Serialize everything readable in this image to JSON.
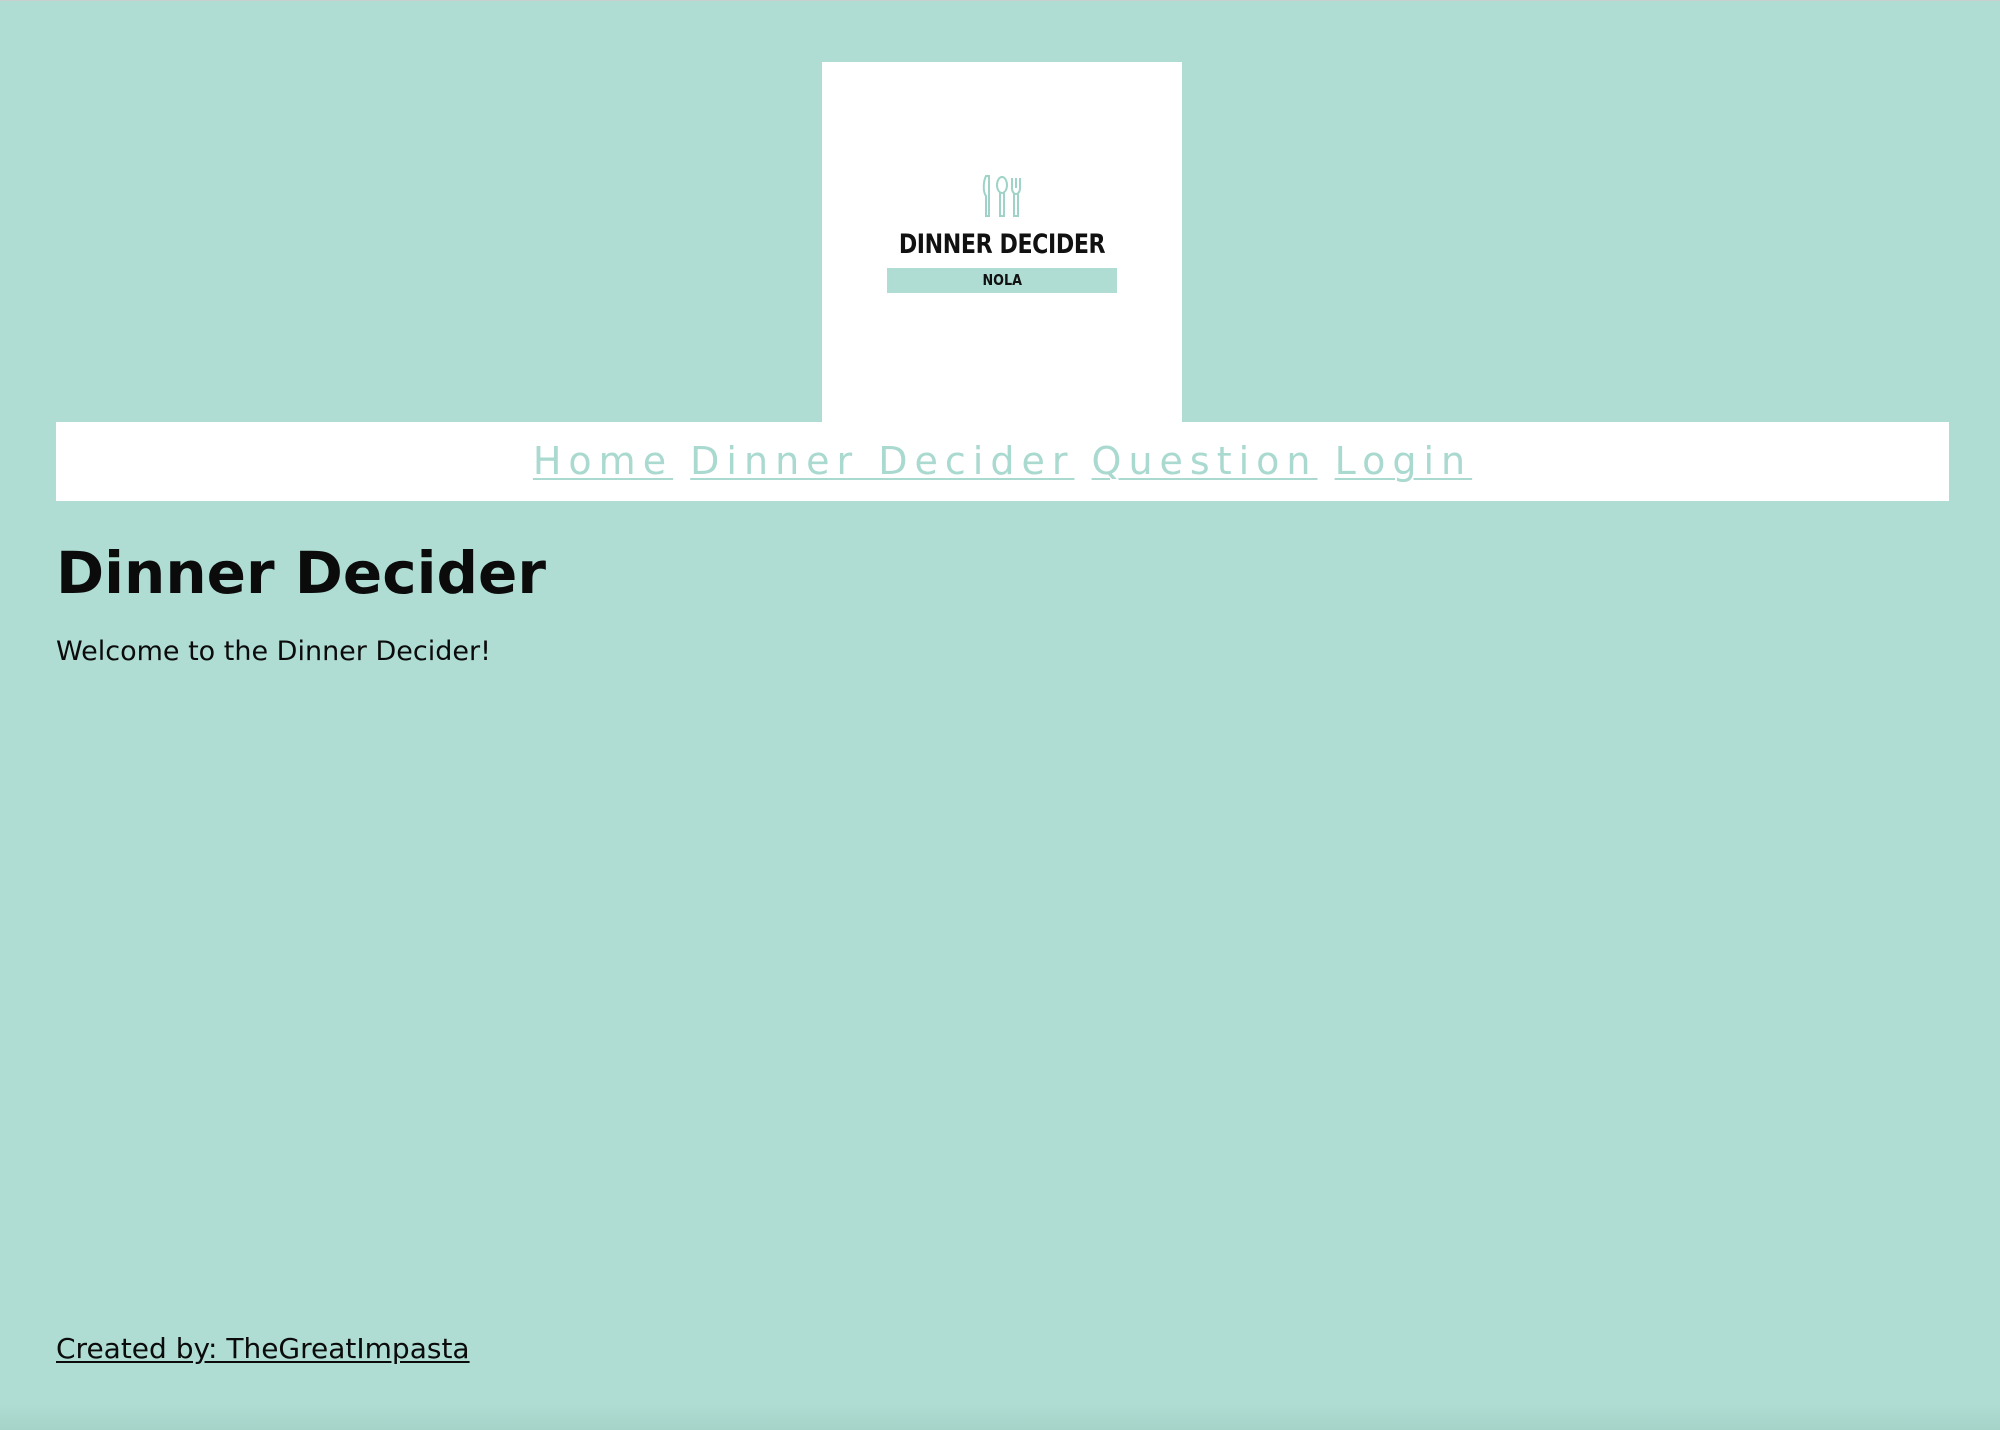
{
  "logo": {
    "icon": "cutlery-icon",
    "title": "DINNER DECIDER",
    "subtitle": "NOLA"
  },
  "nav": {
    "items": [
      {
        "label": "Home"
      },
      {
        "label": "Dinner Decider"
      },
      {
        "label": "Question"
      },
      {
        "label": "Login"
      }
    ]
  },
  "main": {
    "title": "Dinner Decider",
    "welcome": "Welcome to the Dinner Decider!"
  },
  "footer": {
    "credit": "Created by: TheGreatImpasta"
  },
  "colors": {
    "background": "#afddd3",
    "accent": "#a9d9cf",
    "panel": "#ffffff",
    "text": "#0b0b0b"
  }
}
